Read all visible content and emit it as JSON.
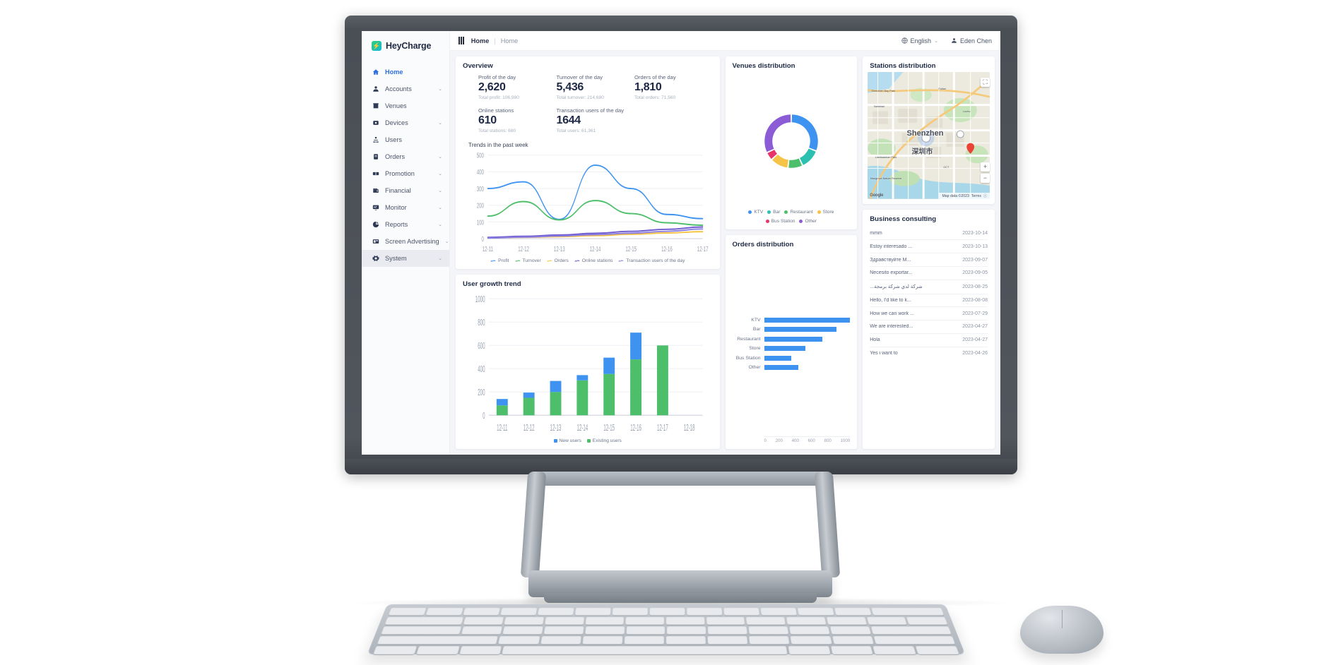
{
  "brand": {
    "name": "HeyCharge",
    "logo_icon": "bolt-icon"
  },
  "sidebar": {
    "items": [
      {
        "label": "Home",
        "icon": "home-icon",
        "expandable": false,
        "active": true
      },
      {
        "label": "Accounts",
        "icon": "account-icon",
        "expandable": true
      },
      {
        "label": "Venues",
        "icon": "venue-icon",
        "expandable": false
      },
      {
        "label": "Devices",
        "icon": "device-icon",
        "expandable": true
      },
      {
        "label": "Users",
        "icon": "users-icon",
        "expandable": false
      },
      {
        "label": "Orders",
        "icon": "orders-icon",
        "expandable": true
      },
      {
        "label": "Promotion",
        "icon": "promotion-icon",
        "expandable": true
      },
      {
        "label": "Financial",
        "icon": "financial-icon",
        "expandable": true
      },
      {
        "label": "Monitor",
        "icon": "monitor-icon",
        "expandable": true
      },
      {
        "label": "Reports",
        "icon": "reports-icon",
        "expandable": true
      },
      {
        "label": "Screen Advertising",
        "icon": "screen-ad-icon",
        "expandable": true
      },
      {
        "label": "System",
        "icon": "gear-icon",
        "expandable": true,
        "selected": true
      }
    ]
  },
  "topbar": {
    "menu_icon": "hamburger-icon",
    "breadcrumb_root": "Home",
    "breadcrumb_sep": "|",
    "breadcrumb_current": "Home",
    "language": "English",
    "user": "Eden Chen"
  },
  "overview": {
    "title": "Overview",
    "stats": [
      {
        "label": "Profit of the day",
        "value": "2,620",
        "sub": "Total profit:  106,980"
      },
      {
        "label": "Turnover of the day",
        "value": "5,436",
        "sub": "Total turnover:  214,680"
      },
      {
        "label": "Orders of the day",
        "value": "1,810",
        "sub": "Total orders:  71,560"
      },
      {
        "label": "Online stations",
        "value": "610",
        "sub": "Total stations:  680"
      },
      {
        "label": "Transaction users of the day",
        "value": "1644",
        "sub": "Total users:  61,361"
      }
    ],
    "trends_subtitle": "Trends in the past week"
  },
  "user_growth": {
    "title": "User growth trend"
  },
  "venues": {
    "title": "Venues distribution"
  },
  "orders_dist": {
    "title": "Orders distribution"
  },
  "stations": {
    "title": "Stations distribution",
    "fullscreen_icon": "expand-icon",
    "zoom_in": "+",
    "zoom_out": "−",
    "city_en": "Shenzhen",
    "city_cn": "深圳市",
    "places": [
      "Shenzhen Bay Park",
      "Nanshan",
      "Futian",
      "Luohu",
      "Mangrove Nature Reserve",
      "Lianhuashan Park",
      "OCT"
    ],
    "attribution": "Map data ©2023",
    "terms": "Terms",
    "google_logo": "Google"
  },
  "consulting": {
    "title": "Business consulting",
    "rows": [
      {
        "text": "mmm",
        "date": "2023-10-14"
      },
      {
        "text": "Estoy interesado ...",
        "date": "2023-10-13"
      },
      {
        "text": "Здравствуйте  M...",
        "date": "2023-09-07"
      },
      {
        "text": "Necesito exportar...",
        "date": "2023-09-05"
      },
      {
        "text": "...شركة لدي شركة برمجة",
        "date": "2023-08-25"
      },
      {
        "text": "Hello, I'd like to k...",
        "date": "2023-08-08"
      },
      {
        "text": "How we can work ...",
        "date": "2023-07-29"
      },
      {
        "text": "We are interested...",
        "date": "2023-04-27"
      },
      {
        "text": "Hola",
        "date": "2023-04-27"
      },
      {
        "text": "Yes i want to",
        "date": "2023-04-26"
      }
    ]
  },
  "colors": {
    "blue": "#3f93f0",
    "green": "#4dbe6a",
    "yellow": "#f5c345",
    "purple": "#8b5cd6",
    "teal": "#2cc0b0",
    "pink": "#e8346a",
    "accent": "#2f6fe4"
  },
  "chart_data": [
    {
      "type": "line",
      "title": "Trends in the past week",
      "x": [
        "12-11",
        "12-12",
        "12-13",
        "12-14",
        "12-15",
        "12-16",
        "12-17"
      ],
      "ylim": [
        0,
        500
      ],
      "yticks": [
        0,
        100,
        200,
        300,
        400,
        500
      ],
      "grid": true,
      "legend_position": "bottom",
      "series": [
        {
          "name": "Profit",
          "color": "#3f93f0",
          "values": [
            300,
            340,
            115,
            440,
            300,
            145,
            120
          ]
        },
        {
          "name": "Turnover",
          "color": "#4dbe6a",
          "values": [
            135,
            222,
            112,
            228,
            150,
            95,
            80
          ]
        },
        {
          "name": "Orders",
          "color": "#f5c345",
          "values": [
            5,
            8,
            12,
            18,
            26,
            34,
            42
          ]
        },
        {
          "name": "Online stations",
          "color": "#6f5ad0",
          "values": [
            8,
            14,
            22,
            32,
            44,
            56,
            70
          ]
        },
        {
          "name": "Transaction users of the day",
          "color": "#8b7fe0",
          "values": [
            4,
            9,
            16,
            24,
            33,
            44,
            58
          ]
        }
      ]
    },
    {
      "type": "bar",
      "title": "User growth trend",
      "stacked": true,
      "categories": [
        "12-11",
        "12-12",
        "12-13",
        "12-14",
        "12-15",
        "12-16",
        "12-17",
        "12-18"
      ],
      "ylim": [
        0,
        1000
      ],
      "yticks": [
        0,
        200,
        400,
        600,
        800,
        1000
      ],
      "series": [
        {
          "name": "Existing users",
          "color": "#4dbe6a",
          "values": [
            85,
            150,
            200,
            300,
            355,
            480,
            600,
            0
          ]
        },
        {
          "name": "New users",
          "color": "#3f93f0",
          "values": [
            55,
            45,
            95,
            45,
            140,
            230,
            0,
            0
          ]
        }
      ]
    },
    {
      "type": "pie",
      "title": "Venues distribution",
      "donut": true,
      "labels": [
        "KTV",
        "Bar",
        "Restaurant",
        "Store",
        "Bus Station",
        "Other"
      ],
      "values": [
        31,
        12,
        9,
        11,
        5,
        32
      ],
      "colors": [
        "#3f93f0",
        "#2cc0b0",
        "#4dbe6a",
        "#f5c345",
        "#e8346a",
        "#8b5cd6"
      ],
      "legend_position": "bottom"
    },
    {
      "type": "bar",
      "title": "Orders distribution",
      "orientation": "horizontal",
      "categories": [
        "KTV",
        "Bar",
        "Restaurant",
        "Store",
        "Bus Station",
        "Other"
      ],
      "values": [
        1000,
        840,
        680,
        480,
        320,
        400
      ],
      "xlim": [
        0,
        1000
      ],
      "xticks": [
        0,
        200,
        400,
        600,
        800,
        1000
      ],
      "color": "#3f93f0"
    }
  ]
}
